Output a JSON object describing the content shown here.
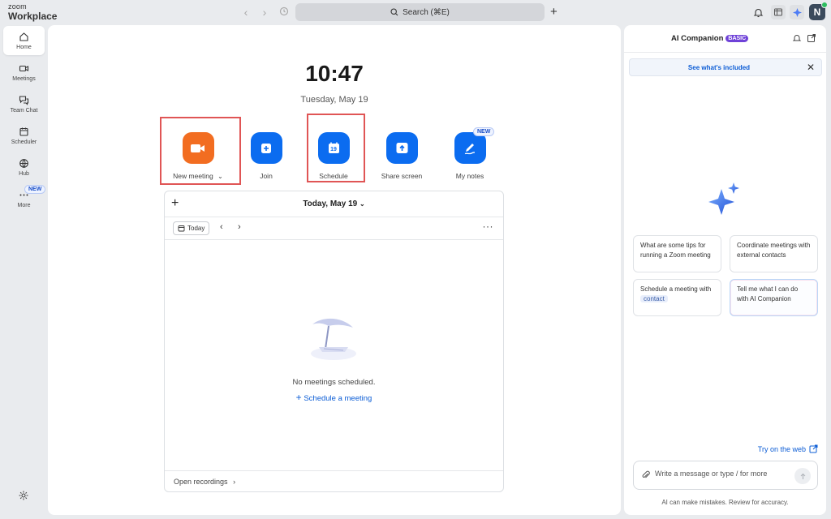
{
  "app": {
    "logo_top": "zoom",
    "logo_bottom": "Workplace"
  },
  "titlebar": {
    "search_label": "Search (⌘E)",
    "avatar_initial": "N"
  },
  "sidebar": {
    "items": [
      {
        "label": "Home",
        "icon": "home-icon"
      },
      {
        "label": "Meetings",
        "icon": "video-icon"
      },
      {
        "label": "Team Chat",
        "icon": "chat-icon"
      },
      {
        "label": "Scheduler",
        "icon": "calendar-icon"
      },
      {
        "label": "Hub",
        "icon": "hub-icon"
      },
      {
        "label": "More",
        "icon": "more-icon"
      }
    ],
    "more_badge": "NEW"
  },
  "main": {
    "time": "10:47",
    "date": "Tuesday, May 19",
    "actions": [
      {
        "label": "New meeting",
        "icon": "video-camera-icon"
      },
      {
        "label": "Join",
        "icon": "plus-icon"
      },
      {
        "label": "Schedule",
        "icon": "calendar-icon",
        "day": "19"
      },
      {
        "label": "Share screen",
        "icon": "upload-arrow-icon"
      },
      {
        "label": "My notes",
        "icon": "pen-icon",
        "badge": "NEW"
      }
    ],
    "calendar": {
      "title": "Today, May 19",
      "today_button": "Today",
      "empty_text": "No meetings scheduled.",
      "schedule_link": "Schedule a meeting",
      "footer": "Open recordings"
    }
  },
  "ai_panel": {
    "title": "AI Companion",
    "tier_badge": "BASIC",
    "banner": "See what's included",
    "suggestions": [
      "What are some tips for running a Zoom meeting",
      "Coordinate meetings with external contacts",
      "Schedule a meeting with",
      "Tell me what I can do with AI Companion"
    ],
    "contact_chip": "contact",
    "try_web": "Try on the web",
    "input_placeholder": "Write a message or type / for more",
    "disclaimer": "AI can make mistakes. Review for accuracy."
  },
  "colors": {
    "accent_blue": "#0b6cf0",
    "new_meeting_orange": "#f26d21",
    "highlight_red": "#e05555",
    "basic_purple": "#6f42d8"
  }
}
